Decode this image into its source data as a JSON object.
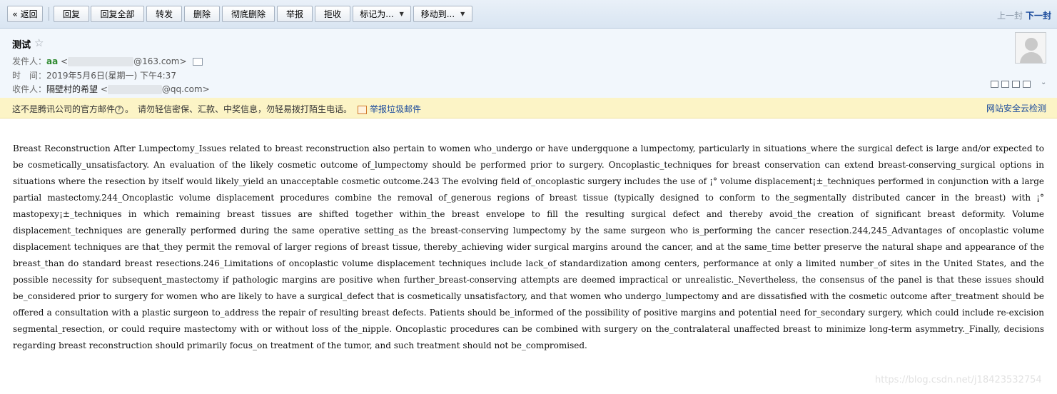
{
  "toolbar": {
    "back": "« 返回",
    "reply": "回复",
    "reply_all": "回复全部",
    "forward": "转发",
    "delete": "删除",
    "delete_perm": "彻底删除",
    "report": "举报",
    "reject": "拒收",
    "mark_as": "标记为...",
    "move_to": "移动到...",
    "prev": "上一封",
    "next": "下一封"
  },
  "header": {
    "subject": "测试",
    "from_label": "发件人：",
    "from_name": "aa",
    "from_addr_prefix": "<",
    "from_addr_suffix": "@163.com>",
    "time_label": "时　间：",
    "time_value": "2019年5月6日(星期一) 下午4:37",
    "to_label": "收件人：",
    "to_name": "隔壁村的希望",
    "to_addr_prefix": "<",
    "to_addr_suffix": "@qq.com>"
  },
  "warning": {
    "text_a": "这不是腾讯公司的官方邮件",
    "q_mark": "?",
    "text_b": "。　请勿轻信密保、汇款、中奖信息，勿轻易拨打陌生电话。",
    "report_link": "举报垃圾邮件",
    "security_check": "网站安全云检测"
  },
  "body": {
    "text": "Breast Reconstruction After Lumpectomy_Issues related to breast reconstruction also pertain to women who_undergo or have undergquone a lumpectomy, particularly in situations_where the surgical defect is large and/or expected to be cosmetically_unsatisfactory. An evaluation of the likely cosmetic outcome of_lumpectomy should be performed prior to surgery. Oncoplastic_techniques for breast conservation can extend breast-conserving_surgical options in situations where the resection by itself would likely_yield an unacceptable cosmetic outcome.243 The evolving field of_oncoplastic surgery includes the use of ¡° volume displacement¡±_techniques performed in conjunction with a large partial mastectomy.244_Oncoplastic volume displacement procedures combine the removal of_generous regions of breast tissue (typically designed to conform to the_segmentally distributed cancer in the breast) with ¡° mastopexy¡±_techniques in which remaining breast tissues are shifted together within_the breast envelope to fill the resulting surgical defect and thereby avoid_the creation of significant breast deformity. Volume displacement_techniques are generally performed during the same operative setting_as the breast-conserving lumpectomy by the same surgeon who is_performing the cancer resection.244,245_Advantages of oncoplastic volume displacement techniques are that_they permit the removal of larger regions of breast tissue, thereby_achieving wider surgical margins around the cancer, and at the same_time better preserve the natural shape and appearance of the breast_than do standard breast resections.246_Limitations of oncoplastic volume displacement techniques include lack_of standardization among centers, performance at only a limited number_of sites in the United States, and the possible necessity for subsequent_mastectomy if pathologic margins are positive when further_breast-conserving attempts are deemed impractical or unrealistic._Nevertheless, the consensus of the panel is that these issues should be_considered prior to surgery for women who are likely to have a surgical_defect that is cosmetically unsatisfactory, and that women who undergo_lumpectomy and are dissatisfied with the cosmetic outcome after_treatment should be offered a consultation with a plastic surgeon to_address the repair of resulting breast defects. Patients should be_informed of the possibility of positive margins and potential need for_secondary surgery, which could include re-excision segmental_resection, or could require mastectomy with or without loss of the_nipple. Oncoplastic procedures can be combined with surgery on the_contralateral unaffected breast to minimize long-term asymmetry._Finally, decisions regarding breast reconstruction should primarily focus_on treatment of the tumor, and such treatment should not be_compromised."
  },
  "watermark": "https://blog.csdn.net/j18423532754",
  "icons": {
    "star": "star-icon",
    "avatar": "default-avatar-icon",
    "contact_card": "contact-card-icon",
    "report": "report-flag-icon"
  },
  "colors": {
    "toolbar_bg": "#dfe9f5",
    "header_bg": "#f2f7fc",
    "warning_bg": "#fcf4c6",
    "link": "#1a4a9c",
    "sender_name": "#2f8a2f"
  }
}
